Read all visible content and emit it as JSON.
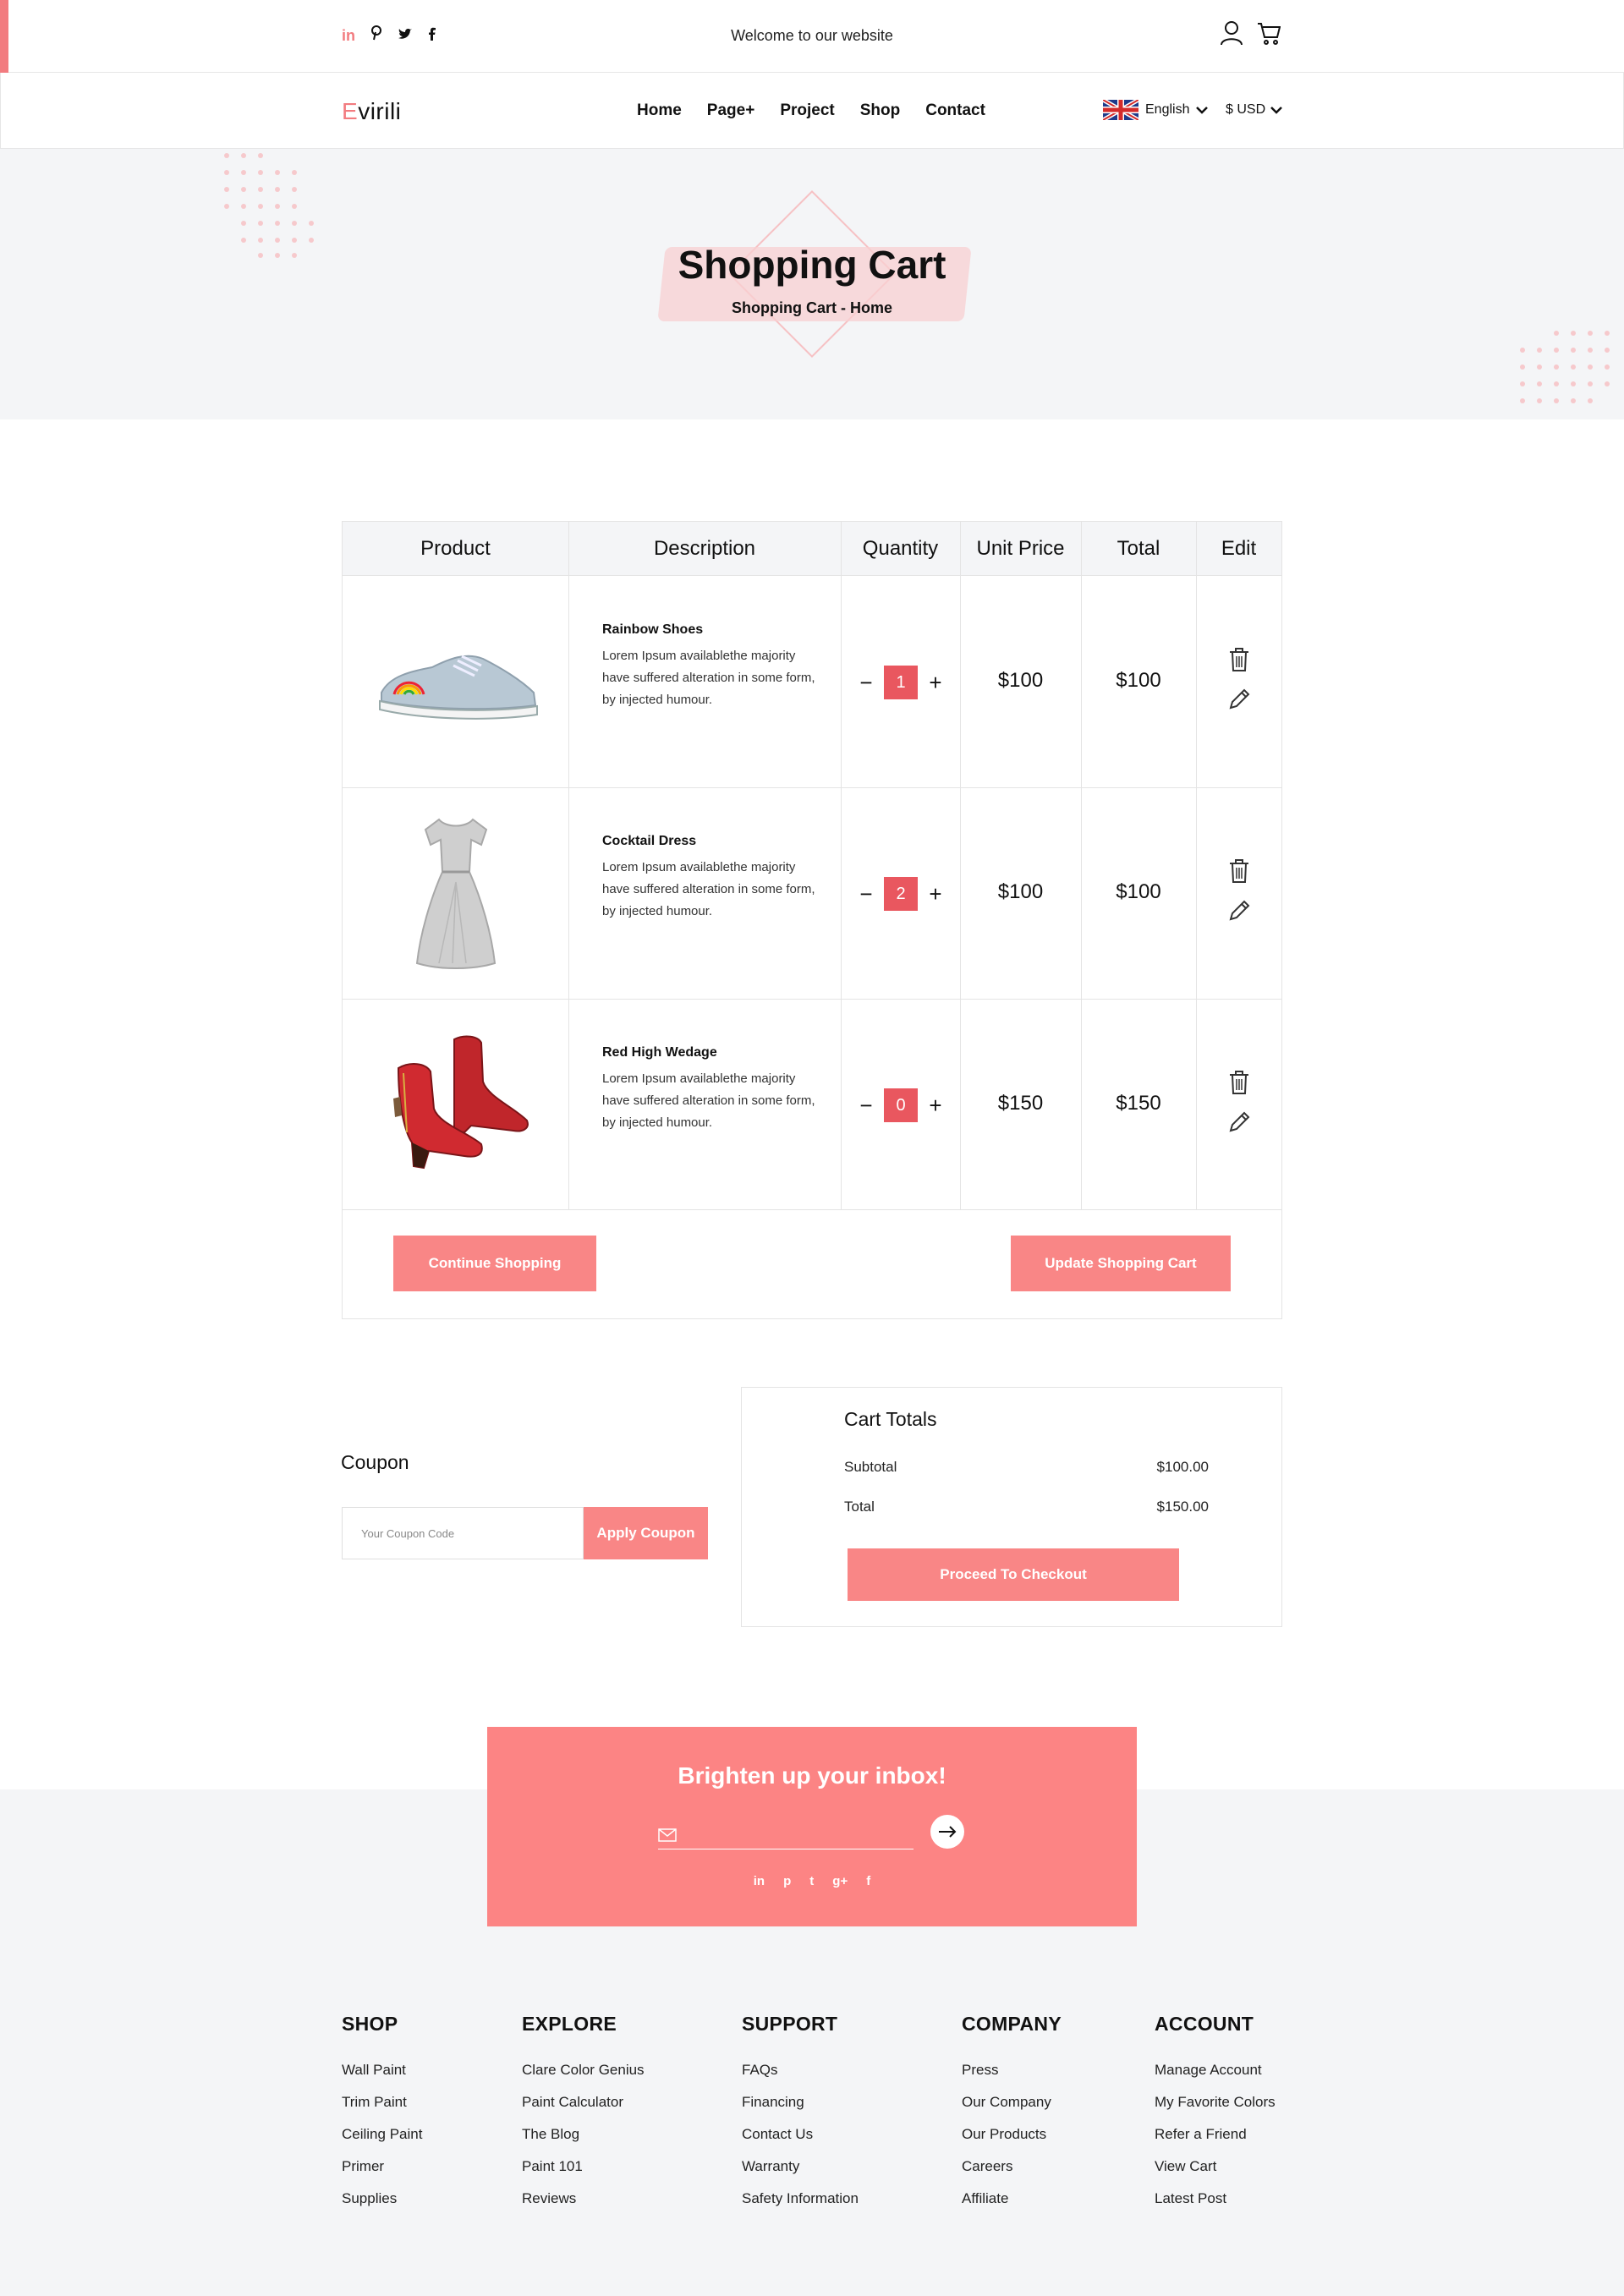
{
  "topbar": {
    "social": [
      "in",
      "p",
      "t",
      "f"
    ],
    "welcome": "Welcome to our website"
  },
  "nav": {
    "logo_first": "E",
    "logo_rest": "virili",
    "menu": [
      "Home",
      "Page+",
      "Project",
      "Shop",
      "Contact"
    ],
    "language": "English",
    "currency": "$ USD"
  },
  "banner": {
    "title": "Shopping Cart",
    "breadcrumb": "Shopping Cart - Home"
  },
  "cart": {
    "headers": [
      "Product",
      "Description",
      "Quantity",
      "Unit Price",
      "Total",
      "Edit"
    ],
    "items": [
      {
        "name": "Rainbow Shoes",
        "desc": "Lorem Ipsum availablethe majority have suffered alteration in some form, by injected humour.",
        "qty": "1",
        "unit_price": "$100",
        "total": "$100"
      },
      {
        "name": "Cocktail Dress",
        "desc": "Lorem Ipsum availablethe majority have suffered alteration in some form, by injected humour.",
        "qty": "2",
        "unit_price": "$100",
        "total": "$100"
      },
      {
        "name": "Red High Wedage",
        "desc": "Lorem Ipsum availablethe majority have suffered alteration in some form, by injected humour.",
        "qty": "0",
        "unit_price": "$150",
        "total": "$150"
      }
    ],
    "minus": "−",
    "plus": "+",
    "continue_label": "Continue Shopping",
    "update_label": "Update Shopping Cart"
  },
  "coupon": {
    "title": "Coupon",
    "placeholder": "Your Coupon Code",
    "apply_label": "Apply Coupon"
  },
  "totals": {
    "title": "Cart Totals",
    "subtotal_label": "Subtotal",
    "subtotal_value": "$100.00",
    "total_label": "Total",
    "total_value": "$150.00",
    "checkout_label": "Proceed To Checkout"
  },
  "newsletter": {
    "title": "Brighten up your inbox!",
    "social": [
      "in",
      "p",
      "t",
      "g+",
      "f"
    ]
  },
  "footer": {
    "columns": [
      {
        "title": "SHOP",
        "links": [
          "Wall Paint",
          "Trim Paint",
          "Ceiling Paint",
          "Primer",
          "Supplies"
        ]
      },
      {
        "title": "EXPLORE",
        "links": [
          "Clare Color Genius",
          "Paint Calculator",
          "The Blog",
          "Paint 101",
          "Reviews"
        ]
      },
      {
        "title": "SUPPORT",
        "links": [
          "FAQs",
          "Financing",
          "Contact Us",
          "Warranty",
          "Safety Information"
        ]
      },
      {
        "title": "COMPANY",
        "links": [
          "Press",
          "Our Company",
          "Our Products",
          "Careers",
          "Affiliate"
        ]
      },
      {
        "title": "ACCOUNT",
        "links": [
          "Manage Account",
          "My Favorite Colors",
          "Refer a Friend",
          "View Cart",
          "Latest Post"
        ]
      }
    ]
  },
  "colors": {
    "accent": "#f98686",
    "qty_box": "#e9575f",
    "banner_bg": "#f4f5f7"
  }
}
